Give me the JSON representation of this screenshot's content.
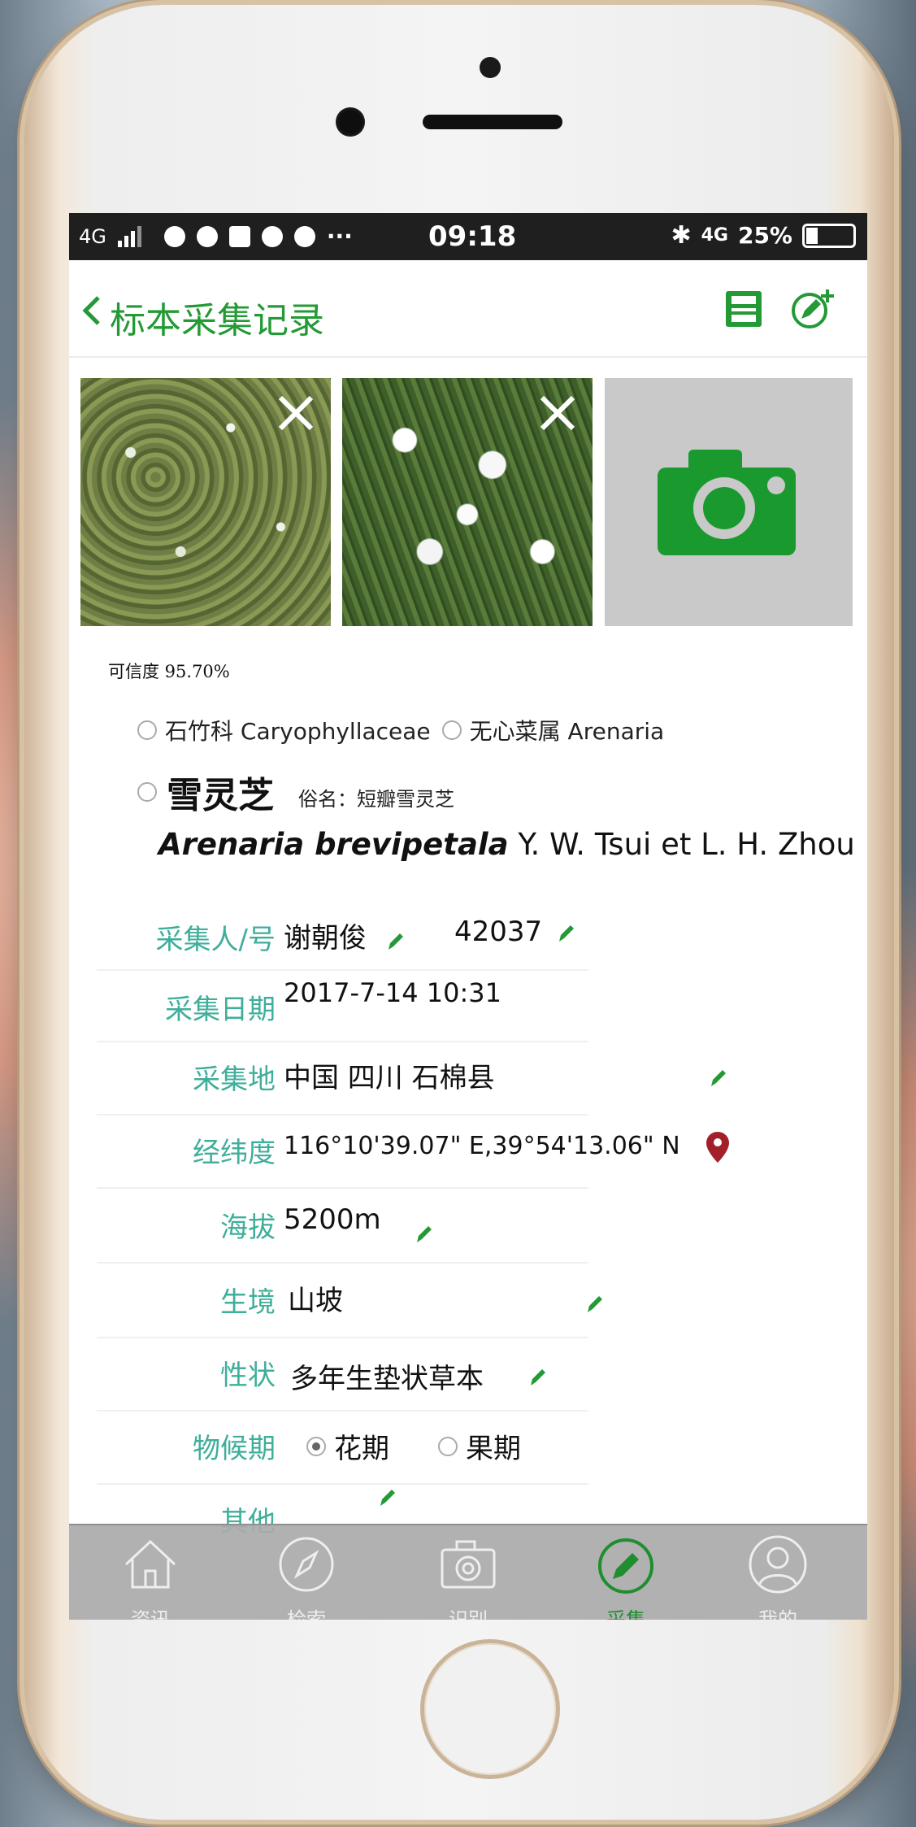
{
  "status_bar": {
    "network": "4G",
    "time": "09:18",
    "right_network": "4G",
    "battery": "25%",
    "more": "···"
  },
  "nav": {
    "title": "标本采集记录"
  },
  "photos": [
    {
      "name": "photo-1",
      "has_close": true
    },
    {
      "name": "photo-2",
      "has_close": true
    }
  ],
  "identification": {
    "confidence": "可信度 95.70%",
    "family": "石竹科 Caryophyllaceae",
    "genus": "无心菜属 Arenaria",
    "species_cn": "雪灵芝",
    "common_name": "俗名：短瓣雪灵芝",
    "latin_name": "Arenaria brevipetala",
    "authority": "Y. W. Tsui et L. H. Zhou"
  },
  "fields": {
    "collector_label": "采集人/号",
    "collector": "谢朝俊",
    "collector_no": "42037",
    "date_label": "采集日期",
    "date": "2017-7-14 10:31",
    "place_label": "采集地",
    "place": "中国 四川 石棉县",
    "coords_label": "经纬度",
    "coords": "116°10'39.07\" E,39°54'13.06\" N",
    "altitude_label": "海拔",
    "altitude": "5200m",
    "habitat_label": "生境",
    "habitat": "山坡",
    "trait_label": "性状",
    "trait": "多年生垫状草本",
    "phenology_label": "物候期",
    "phenology_options": [
      "花期",
      "果期"
    ],
    "phenology_selected": "花期",
    "other_label": "其他"
  },
  "tabbar": {
    "tabs": [
      {
        "label": "资讯",
        "icon": "home-icon"
      },
      {
        "label": "检索",
        "icon": "compass-icon"
      },
      {
        "label": "识别",
        "icon": "camera-icon"
      },
      {
        "label": "采集",
        "icon": "edit-icon",
        "active": true
      },
      {
        "label": "我的",
        "icon": "profile-icon"
      }
    ]
  },
  "colors": {
    "accent": "#239a35",
    "label": "#3fae9a",
    "pin": "#a3202a"
  }
}
